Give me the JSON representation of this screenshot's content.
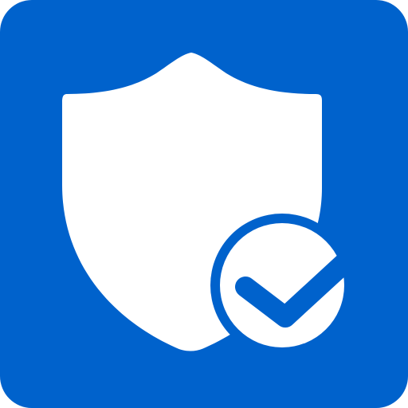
{
  "icon": {
    "name": "shield-check-icon",
    "colors": {
      "background": "#0062CC",
      "foreground": "#FFFFFF"
    }
  }
}
